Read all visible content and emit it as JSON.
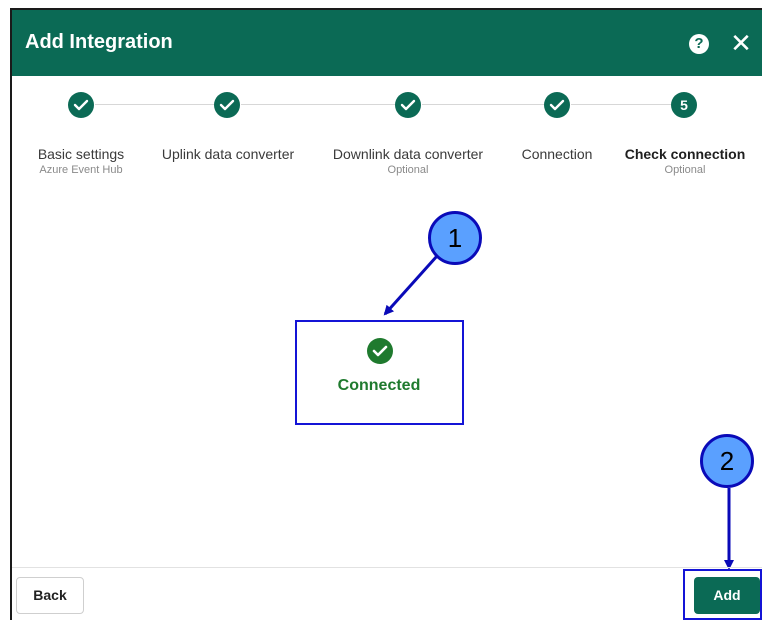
{
  "dialog": {
    "title": "Add Integration",
    "help_icon": "question-circle-icon",
    "close_icon": "close-icon"
  },
  "stepper": {
    "steps": [
      {
        "label": "Basic settings",
        "sublabel": "Azure Event Hub",
        "state": "completed"
      },
      {
        "label": "Uplink data converter",
        "sublabel": "",
        "state": "completed"
      },
      {
        "label": "Downlink data converter",
        "sublabel": "Optional",
        "state": "completed"
      },
      {
        "label": "Connection",
        "sublabel": "",
        "state": "completed"
      },
      {
        "label": "Check connection",
        "sublabel": "Optional",
        "state": "active",
        "number": "5"
      }
    ]
  },
  "status": {
    "text": "Connected",
    "icon": "check-circle-icon",
    "color": "#1f7a2e"
  },
  "callouts": [
    {
      "number": "1"
    },
    {
      "number": "2"
    }
  ],
  "footer": {
    "back_label": "Back",
    "add_label": "Add"
  },
  "colors": {
    "primary": "#0b6a55",
    "annotation": "#1414d6",
    "callout_fill": "#5aa0ff"
  }
}
